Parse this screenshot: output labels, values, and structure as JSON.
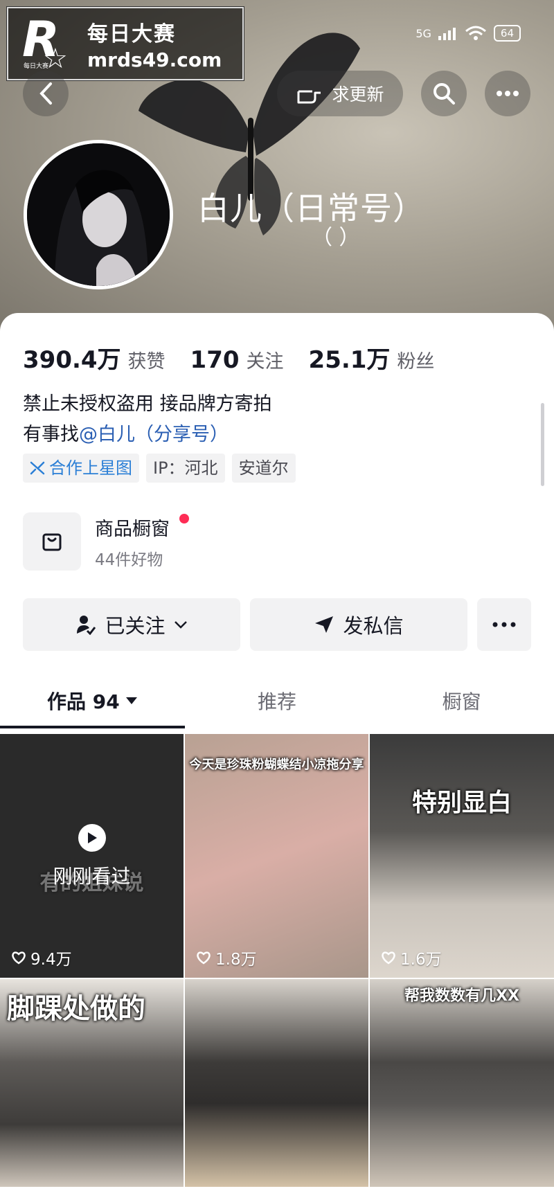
{
  "watermark": {
    "logo_text": "R",
    "logo_small": "每日大赛",
    "line1": "每日大赛",
    "line2": "mrds49.com"
  },
  "status_bar": {
    "network": "5G",
    "battery": "64"
  },
  "header": {
    "update_label": "求更新"
  },
  "profile": {
    "nickname": "白儿（日常号）",
    "nickname_sub": "（ ）"
  },
  "stats": {
    "likes_value": "390.4万",
    "likes_label": "获赞",
    "following_value": "170",
    "following_label": "关注",
    "followers_value": "25.1万",
    "followers_label": "粉丝"
  },
  "bio": {
    "line1": "禁止未授权盗用 接品牌方寄拍",
    "line2_prefix": "有事找",
    "line2_mention": "@白儿（分享号）"
  },
  "tags": {
    "star_map": "合作上星图",
    "ip": "IP：河北",
    "location": "安道尔"
  },
  "shop": {
    "title": "商品橱窗",
    "subtitle": "44件好物"
  },
  "actions": {
    "follow": "已关注",
    "message": "发私信"
  },
  "tabs": {
    "works": "作品 94",
    "recommend": "推荐",
    "showcase": "橱窗"
  },
  "grid": [
    {
      "likes": "9.4万",
      "watched": "刚刚看过",
      "caption": "有的姐妹说",
      "bg": "#2a2a2a"
    },
    {
      "likes": "1.8万",
      "caption": "今天是珍珠粉蝴蝶结小凉拖分享",
      "bg": "#c9a29a"
    },
    {
      "likes": "1.6万",
      "caption": "特别显白",
      "bg": "#8d8a85"
    },
    {
      "likes": "",
      "caption": "脚踝处做的",
      "bg": "#7d7a76"
    },
    {
      "likes": "",
      "caption": "",
      "bg": "#6a6764"
    },
    {
      "likes": "",
      "caption": "帮我数数有几XX",
      "bg": "#8b8884"
    }
  ]
}
